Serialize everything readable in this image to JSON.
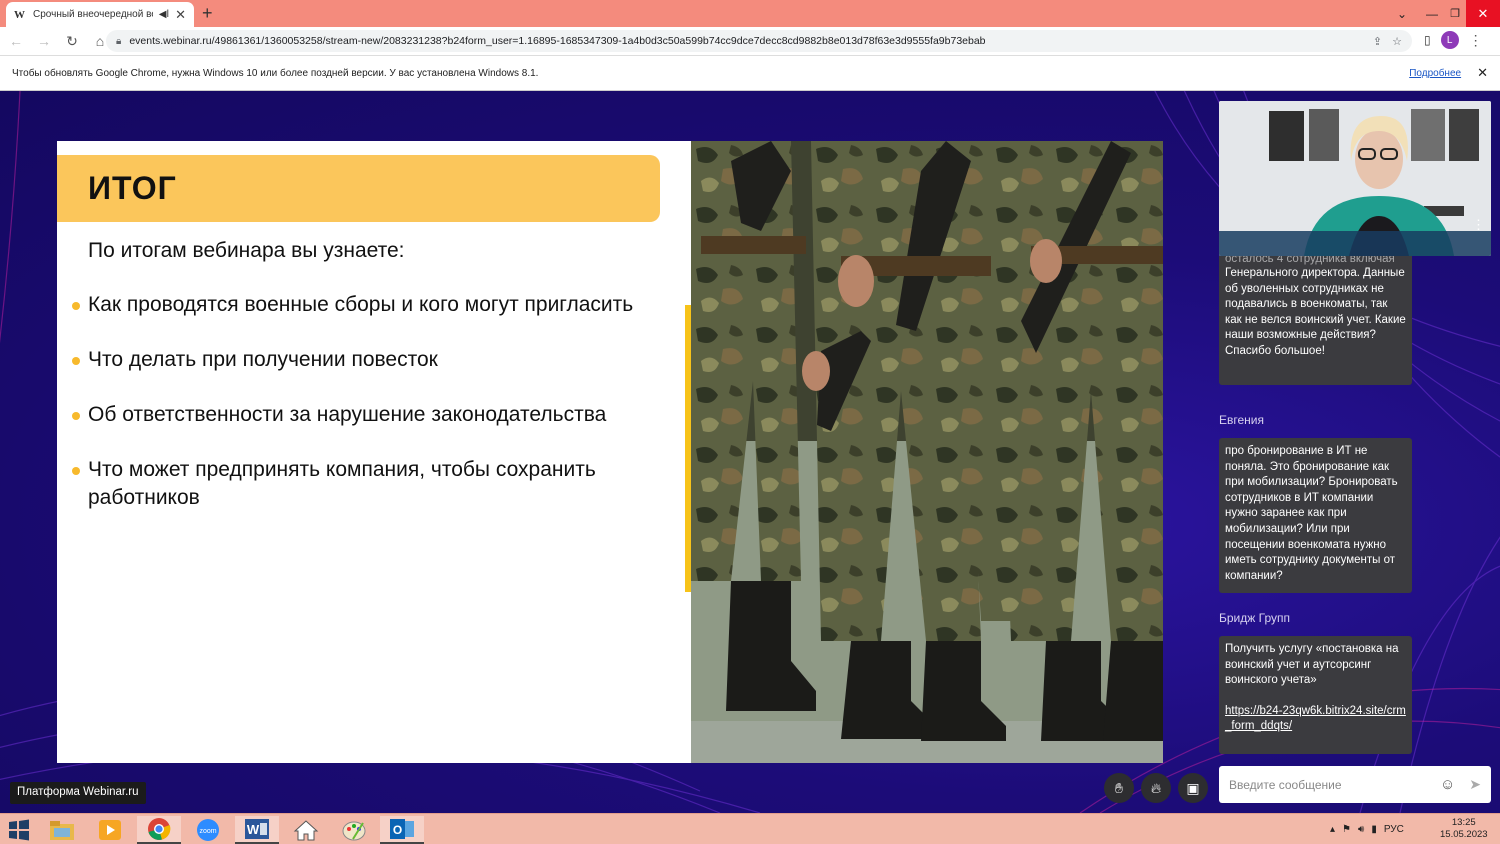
{
  "browser": {
    "tab_favicon": "W",
    "tab_title": "Срочный внеочередной ве",
    "tab_audio_icon": "speaker-icon",
    "tab_close": "✕",
    "new_tab": "+",
    "url": "events.webinar.ru/49861361/1360053258/stream-new/2083231238?b24form_user=1.16895-1685347309-1a4b0d3c50a599b74cc9dce7decc8cd9882b8e013d78f63e3d9555fa9b73ebab",
    "profile_letter": "L"
  },
  "infobar": {
    "message": "Чтобы обновлять Google Chrome, нужна Windows 10 или более поздней версии. У вас установлена Windows 8.1.",
    "link": "Подробнее",
    "close": "✕"
  },
  "slide": {
    "title": "ИТОГ",
    "subtitle": "По итогам вебинара вы узнаете:",
    "bullets": [
      "Как проводятся военные сборы и кого могут пригласить",
      "Что делать при получении повесток",
      "Об ответственности за нарушение законодательства",
      "Что может предпринять компания, чтобы сохранить работников"
    ]
  },
  "chat": {
    "messages": [
      {
        "author": "",
        "text_partial": "осталось 4 сотрудника включая",
        "text": "Генерального директора. Данные об уволенных сотрудниках не подавались в военкоматы, так как не велся воинский учет. Какие наши возможные действия? Спасибо большое!"
      },
      {
        "author": "Евгения",
        "text": "про бронирование в ИТ не поняла. Это бронирование как при мобилизации? Бронировать сотрудников в ИТ компании нужно заранее как при мобилизации? Или при посещении военкомата нужно иметь сотруднику документы от компании?"
      },
      {
        "author": "Бридж Групп",
        "text": "Получить услугу «постановка на воинский учет и аутсорсинг воинского учета»",
        "link": "https://b24-23qw6k.bitrix24.site/crm_form_ddqts/"
      }
    ],
    "input_placeholder": "Введите сообщение"
  },
  "controls": [
    "raise-hand-icon",
    "fire-icon",
    "picture-in-picture-icon"
  ],
  "branding": "Платформа Webinar.ru",
  "taskbar": {
    "apps": [
      "file-explorer-icon",
      "media-player-icon",
      "chrome-icon",
      "zoom-icon",
      "word-icon",
      "home-icon",
      "paint-icon",
      "outlook-icon"
    ],
    "zoom_label": "zoom",
    "word_label": "W",
    "outlook_label": "O",
    "language": "РУС",
    "time": "13:25",
    "date": "15.05.2023"
  },
  "colors": {
    "tab_strip": "#f48b7d",
    "stage_bg": "#1c0c78",
    "title_accent": "#fbc65b",
    "bullet_dot": "#f7b92c",
    "chat_bubble": "#3b3b3f"
  }
}
